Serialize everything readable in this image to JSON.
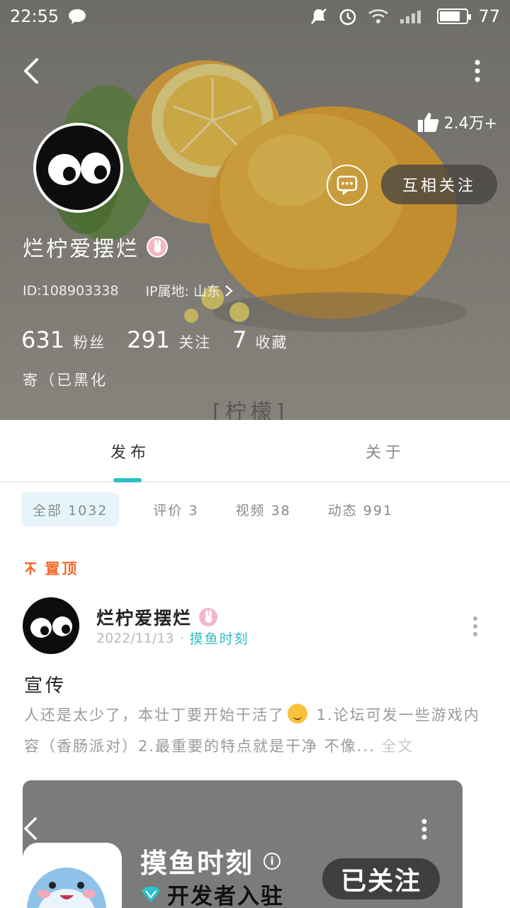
{
  "status_bar": {
    "time": "22:55",
    "battery": "77",
    "battery_level": 0.77
  },
  "profile": {
    "likes": "2.4万+",
    "nickname": "烂柠爱摆烂",
    "id_text": "ID:108903338",
    "ip_text": "IP属地: 山东",
    "follow_button": "互相关注",
    "bio": "寄（已黑化",
    "banner_caption": "[柠檬]",
    "stats": [
      {
        "value": "631",
        "label": "粉丝"
      },
      {
        "value": "291",
        "label": "关注"
      },
      {
        "value": "7",
        "label": "收藏"
      }
    ]
  },
  "tabs": {
    "active": "发布",
    "other": "关于"
  },
  "filters": [
    {
      "label": "全部 1032"
    },
    {
      "label": "评价 3"
    },
    {
      "label": "视频 38"
    },
    {
      "label": "动态 991"
    }
  ],
  "post": {
    "pinned_label": "置顶",
    "author": "烂柠爱摆烂",
    "date": "2022/11/13",
    "dot": "·",
    "tag": "摸鱼时刻",
    "title": "宣传",
    "body_part1": "人还是太少了，本壮丁要开始干活了",
    "body_part2": " 1.论坛可发一些游戏内容（香肠派对）2.最重要的特点就是干净 不像...",
    "more": " 全文"
  },
  "embed": {
    "title": "摸鱼时刻",
    "dev_label": "开发者入驻",
    "follow_label": "已关注"
  },
  "colors": {
    "accent": "#2fc0c6",
    "pinned": "#f26a2c",
    "chip_bg": "#e6f5f9"
  }
}
